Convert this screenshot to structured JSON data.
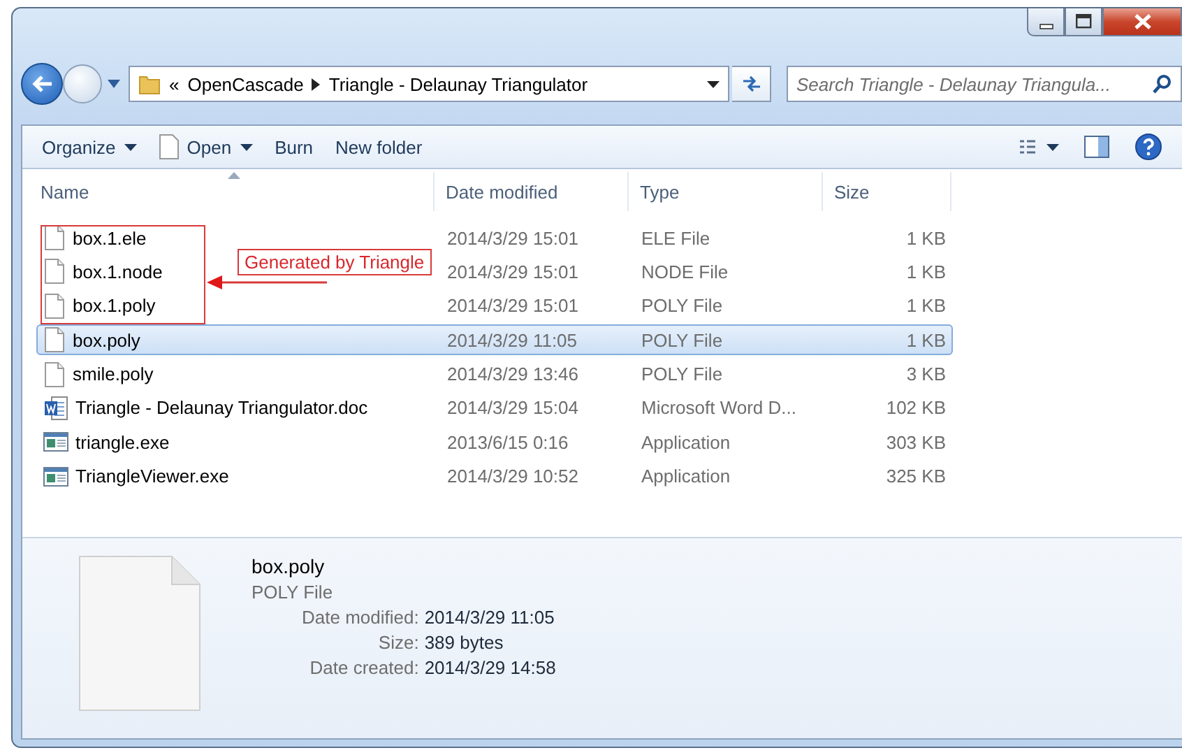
{
  "window": {
    "controls": [
      {
        "kind": "minimize"
      },
      {
        "kind": "maximize"
      },
      {
        "kind": "close"
      }
    ]
  },
  "navigation": {
    "overflow": "«",
    "breadcrumbs": [
      "OpenCascade",
      "Triangle - Delaunay Triangulator"
    ],
    "search": {
      "placeholder": "Search Triangle - Delaunay Triangula..."
    }
  },
  "toolbar": [
    {
      "label": "Organize",
      "has_menu": true,
      "icon": false
    },
    {
      "label": "Open",
      "has_menu": true,
      "icon": true
    },
    {
      "label": "Burn",
      "has_menu": false,
      "icon": false
    },
    {
      "label": "New folder",
      "has_menu": false,
      "icon": false
    }
  ],
  "columns": [
    {
      "label": "Name",
      "sorted": true
    },
    {
      "label": "Date modified",
      "sorted": false
    },
    {
      "label": "Type",
      "sorted": false
    },
    {
      "label": "Size",
      "sorted": false
    }
  ],
  "files": [
    {
      "name": "box.1.ele",
      "date": "2014/3/29 15:01",
      "type": "ELE File",
      "size": "1 KB",
      "kind": "blank",
      "selected": false
    },
    {
      "name": "box.1.node",
      "date": "2014/3/29 15:01",
      "type": "NODE File",
      "size": "1 KB",
      "kind": "blank",
      "selected": false
    },
    {
      "name": "box.1.poly",
      "date": "2014/3/29 15:01",
      "type": "POLY File",
      "size": "1 KB",
      "kind": "blank",
      "selected": false
    },
    {
      "name": "box.poly",
      "date": "2014/3/29 11:05",
      "type": "POLY File",
      "size": "1 KB",
      "kind": "blank",
      "selected": true
    },
    {
      "name": "smile.poly",
      "date": "2014/3/29 13:46",
      "type": "POLY File",
      "size": "3 KB",
      "kind": "blank",
      "selected": false
    },
    {
      "name": "Triangle - Delaunay Triangulator.doc",
      "date": "2014/3/29 15:04",
      "type": "Microsoft Word D...",
      "size": "102 KB",
      "kind": "word",
      "selected": false
    },
    {
      "name": "triangle.exe",
      "date": "2013/6/15 0:16",
      "type": "Application",
      "size": "303 KB",
      "kind": "exe",
      "selected": false
    },
    {
      "name": "TriangleViewer.exe",
      "date": "2014/3/29 10:52",
      "type": "Application",
      "size": "325 KB",
      "kind": "exe",
      "selected": false
    }
  ],
  "annotation": {
    "text": "Generated by Triangle"
  },
  "details": {
    "name": "box.poly",
    "type": "POLY File",
    "properties": [
      {
        "label": "Date modified:",
        "value": "2014/3/29 11:05"
      },
      {
        "label": "Size:",
        "value": "389 bytes"
      },
      {
        "label": "Date created:",
        "value": "2014/3/29 14:58"
      }
    ]
  }
}
